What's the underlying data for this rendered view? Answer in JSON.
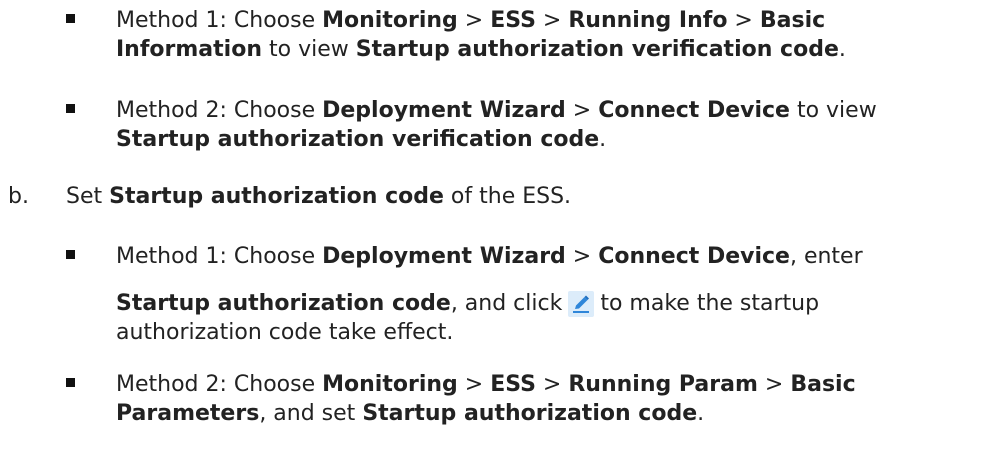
{
  "items": {
    "b1": {
      "prefix": "Method 1: Choose ",
      "p1": "Monitoring",
      "sep1": " > ",
      "p2": "ESS",
      "sep2": " > ",
      "p3": "Running Info",
      "sep3": " > ",
      "p4": "Basic",
      "p4b": "Information",
      "mid": " to view ",
      "target": "Startup authorization verification code",
      "end": "."
    },
    "b2": {
      "prefix": "Method 2: Choose ",
      "p1": "Deployment Wizard",
      "sep1": " > ",
      "p2": "Connect Device",
      "mid": " to view",
      "target": "Startup authorization verification code",
      "end": "."
    },
    "b": {
      "marker": "b.",
      "prefix": "Set ",
      "term": "Startup authorization code",
      "suffix": " of the ESS."
    },
    "b3": {
      "prefix": "Method 1: Choose ",
      "p1": "Deployment Wizard",
      "sep1": " > ",
      "p2": "Connect Device",
      "mid": ", enter",
      "term": "Startup authorization code",
      "mid2": ", and click",
      "after_icon": "to make the startup",
      "line3": "authorization code take effect."
    },
    "b4": {
      "prefix": "Method 2: Choose ",
      "p1": "Monitoring",
      "sep1": " > ",
      "p2": "ESS",
      "sep2": " > ",
      "p3": "Running Param",
      "sep3": " > ",
      "p4": "Basic",
      "p4b": "Parameters",
      "mid": ", and set ",
      "term": "Startup authorization code",
      "end": "."
    }
  },
  "icons": {
    "edit_icon": "pencil-edit-icon",
    "edit_color": "#3a8ee6",
    "edit_bg": "#cfe6fb"
  }
}
